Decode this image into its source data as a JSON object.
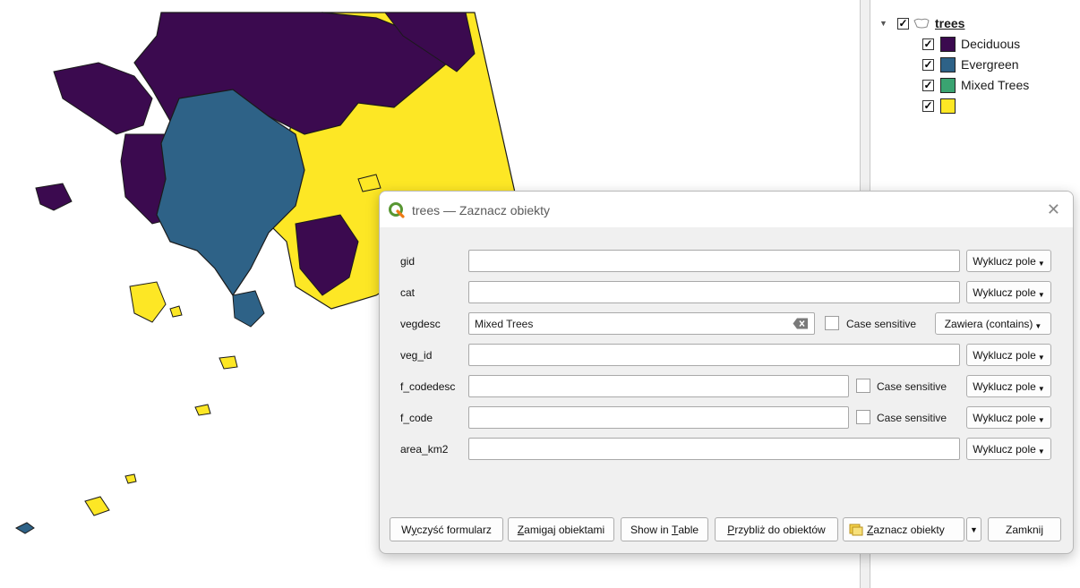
{
  "layers_panel": {
    "layer": {
      "name": "trees",
      "checked": true
    },
    "legend": [
      {
        "label": "Deciduous",
        "color": "#3b0a4f",
        "checked": true
      },
      {
        "label": "Evergreen",
        "color": "#2e6287",
        "checked": true
      },
      {
        "label": "Mixed Trees",
        "color": "#3aa371",
        "checked": true
      },
      {
        "label": "",
        "color": "#fde725",
        "checked": true
      }
    ]
  },
  "dialog": {
    "title": "trees — Zaznacz obiekty",
    "fields": [
      {
        "name": "gid",
        "value": "",
        "button": "Wyklucz pole"
      },
      {
        "name": "cat",
        "value": "",
        "button": "Wyklucz pole"
      },
      {
        "name": "vegdesc",
        "value": "Mixed Trees",
        "case_label": "Case sensitive",
        "button": "Zawiera (contains)"
      },
      {
        "name": "veg_id",
        "value": "",
        "button": "Wyklucz pole"
      },
      {
        "name": "f_codedesc",
        "value": "",
        "case_label": "Case sensitive",
        "button": "Wyklucz pole"
      },
      {
        "name": "f_code",
        "value": "",
        "case_label": "Case sensitive",
        "button": "Wyklucz pole"
      },
      {
        "name": "area_km2",
        "value": "",
        "button": "Wyklucz pole"
      }
    ],
    "footer": {
      "clear_pre": "W",
      "clear_u": "y",
      "clear_post": "czyść formularz",
      "flash_pre": "",
      "flash_u": "Z",
      "flash_post": "amigaj obiektami",
      "table_pre": "Show in ",
      "table_u": "T",
      "table_post": "able",
      "zoom_pre": "",
      "zoom_u": "P",
      "zoom_post": "rzybliż do obiektów",
      "select_pre": "",
      "select_u": "Z",
      "select_post": "aznacz obiekty",
      "close": "Zamknij"
    }
  },
  "colors": {
    "deciduous": "#3b0a4f",
    "evergreen": "#2e6287",
    "mixed": "#3aa371",
    "other": "#fde725"
  }
}
